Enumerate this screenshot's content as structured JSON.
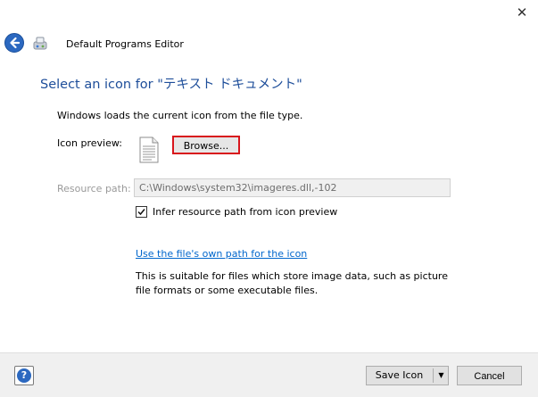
{
  "window": {
    "title": "Default Programs Editor",
    "close_glyph": "✕",
    "back_icon": "back-arrow-icon",
    "app_icon": "default-programs-icon"
  },
  "main": {
    "heading": "Select an icon for \"テキスト ドキュメント\"",
    "description": "Windows loads the current icon from the file type.",
    "icon_preview_label": "Icon preview:",
    "preview_icon": "text-document-icon",
    "browse_label": "Browse...",
    "resource_path_label": "Resource path:",
    "resource_path_value": "C:\\Windows\\system32\\imageres.dll,-102",
    "infer_checkbox": {
      "label": "Infer resource path from icon preview",
      "checked": true
    },
    "use_own_path_link": "Use the file's own path for the icon",
    "info_text": "This is suitable for files which store image data, such as picture file formats or some executable files."
  },
  "footer": {
    "help_glyph": "?",
    "save_label": "Save Icon",
    "save_dropdown_glyph": "▼",
    "cancel_label": "Cancel"
  },
  "colors": {
    "heading": "#1e4e9a",
    "link": "#0066cc",
    "browse_highlight": "#d8151c",
    "back_button": "#2b68c0"
  }
}
